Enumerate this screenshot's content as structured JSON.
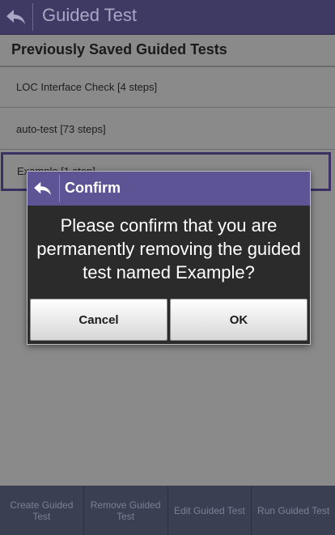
{
  "header": {
    "title": "Guided Test"
  },
  "section": {
    "title": "Previously Saved Guided Tests"
  },
  "tests": [
    "LOC Interface Check [4 steps]",
    "auto-test [73 steps]",
    "Example [1 step]"
  ],
  "dialog": {
    "title": "Confirm",
    "message": "Please confirm that you are permanently removing the guided test named Example?",
    "cancel_label": "Cancel",
    "ok_label": "OK"
  },
  "footer": [
    "Create Guided Test",
    "Remove Guided Test",
    "Edit Guided Test",
    "Run Guided Test"
  ],
  "colors": {
    "header_bg": "#3f3a63",
    "dialog_header_bg": "#5d5496",
    "selected_border": "#3b2f63",
    "footer_bg": "#3a3f52"
  },
  "icons": {
    "back": "back-arrow-icon"
  }
}
